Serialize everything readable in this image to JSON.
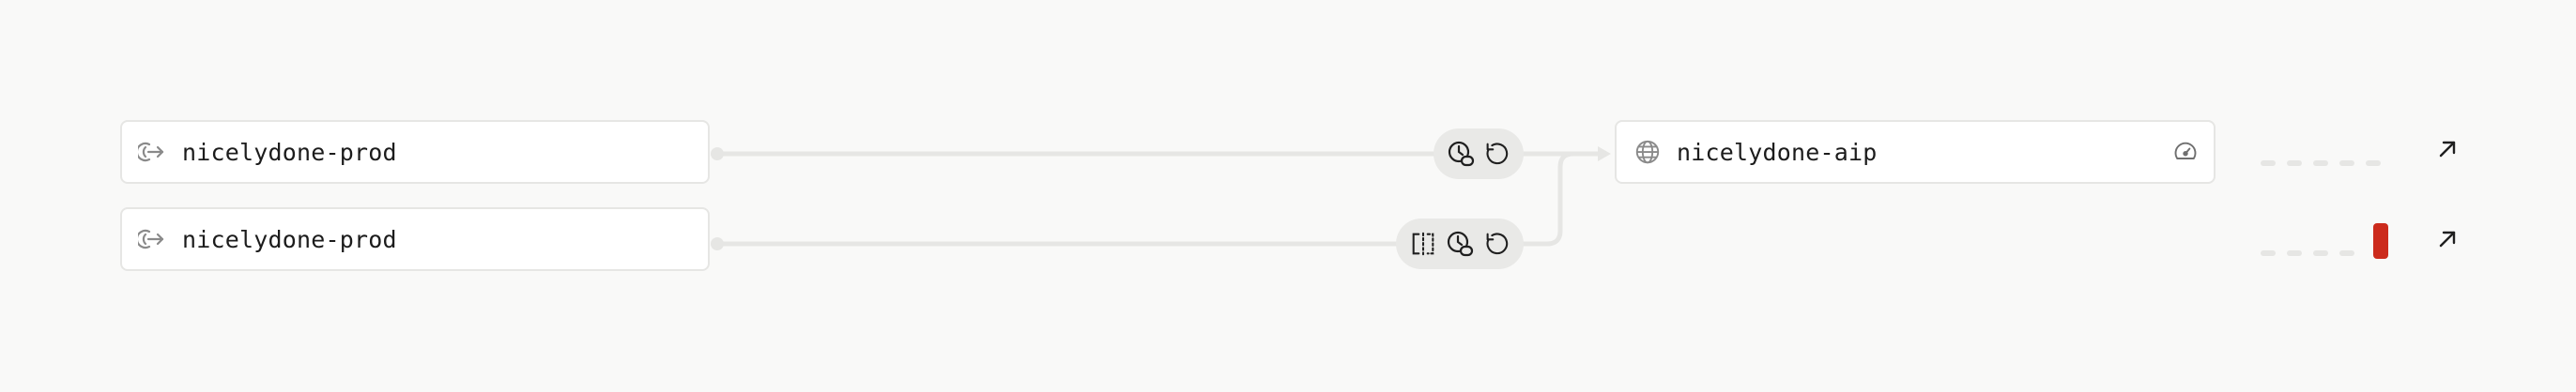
{
  "connections": [
    {
      "source": {
        "name": "nicelydone-prod",
        "icon": "egress-icon"
      },
      "controls": [
        "clock-badge-icon",
        "refresh-icon"
      ]
    },
    {
      "source": {
        "name": "nicelydone-prod",
        "icon": "egress-icon"
      },
      "controls": [
        "split-view-icon",
        "clock-badge-icon",
        "refresh-icon"
      ]
    }
  ],
  "target": {
    "name": "nicelydone-aip",
    "icon": "globe-icon",
    "status_icon": "gauge-icon"
  },
  "status": [
    {
      "state": "idle",
      "color": "#e6e6e4"
    },
    {
      "state": "error",
      "color": "#cc2b1c"
    }
  ],
  "colors": {
    "background": "#f9f9f8",
    "wire": "#e6e6e4",
    "pill": "#e9e9e7",
    "error": "#cc2b1c"
  }
}
